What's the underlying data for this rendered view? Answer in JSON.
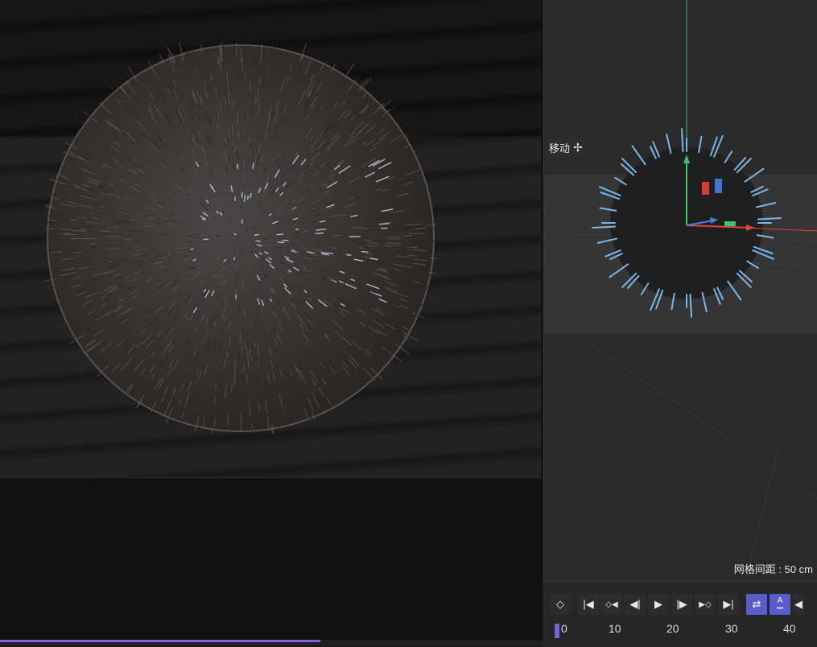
{
  "viewport": {
    "move_tool_label": "移动",
    "move_icon": "move-cross-icon",
    "grid_spacing_label": "网格间距 : 50 cm"
  },
  "timeline": {
    "ticks": [
      "0",
      "10",
      "20",
      "30",
      "40"
    ],
    "buttons": [
      {
        "name": "keyframe-button",
        "glyph": "◇"
      },
      {
        "name": "go-to-start-button",
        "glyph": "|◀"
      },
      {
        "name": "prev-key-button",
        "glyph": "◆◀"
      },
      {
        "name": "prev-frame-button",
        "glyph": "◀|"
      },
      {
        "name": "play-button",
        "glyph": "▶"
      },
      {
        "name": "next-frame-button",
        "glyph": "|▶"
      },
      {
        "name": "next-key-button",
        "glyph": "▶◇"
      },
      {
        "name": "go-to-end-button",
        "glyph": "▶|"
      }
    ],
    "loop_active": true,
    "auto_key_label": "A",
    "current_frame": 0
  },
  "status_bar": {
    "progress_percent": 59
  },
  "colors": {
    "accent": "#5a5ccc",
    "axis_x": "#e0443a",
    "axis_y": "#3bc46a",
    "axis_z": "#4a7de0",
    "hair": "#7ab6e8"
  }
}
